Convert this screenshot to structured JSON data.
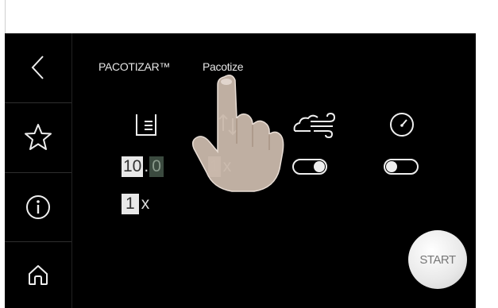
{
  "sidebar": {
    "items": [
      {
        "name": "back",
        "icon": "chevron-left-icon"
      },
      {
        "name": "favorites",
        "icon": "star-icon"
      },
      {
        "name": "info",
        "icon": "info-icon"
      },
      {
        "name": "home",
        "icon": "home-icon"
      }
    ]
  },
  "tabs": [
    {
      "label": "PACOTIZAR™"
    },
    {
      "label": "Pacotize"
    }
  ],
  "settings": {
    "portions": {
      "integer": "10",
      "separator": ".",
      "decimal": "0",
      "icon": "container-level-icon"
    },
    "depth": {
      "value": "1",
      "suffix": "x",
      "icon": "up-down-arrows-icon"
    },
    "air": {
      "toggle_on": true,
      "icon": "air-flow-icon"
    },
    "pressure": {
      "toggle_on": false,
      "icon": "gauge-icon"
    },
    "repeat": {
      "value": "1",
      "suffix": "x"
    }
  },
  "start_button": {
    "label": "START"
  },
  "colors": {
    "screen_bg": "#000000",
    "foreground": "#eeeeee",
    "start_bg": "#eeeeee",
    "start_text": "#777777"
  }
}
